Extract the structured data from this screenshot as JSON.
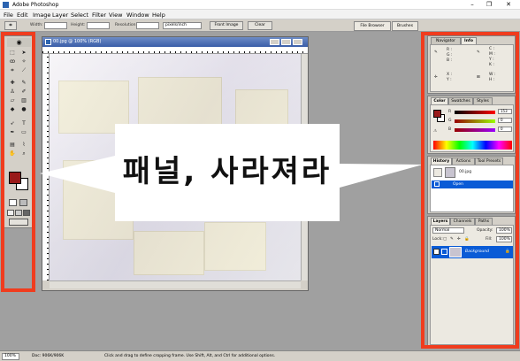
{
  "app": {
    "title": "Adobe Photoshop"
  },
  "window_controls": {
    "minimize": "–",
    "restore": "❐",
    "close": "✕"
  },
  "menu": [
    "File",
    "Edit",
    "Image",
    "Layer",
    "Select",
    "Filter",
    "View",
    "Window",
    "Help"
  ],
  "options_bar": {
    "tool_glyph": "⌗",
    "width_label": "Width:",
    "height_label": "Height:",
    "resolution_label": "Resolution:",
    "resolution_unit": "pixels/inch",
    "front_image": "Front Image",
    "clear": "Clear"
  },
  "palette_well": {
    "file_browser": "File Browser",
    "brushes": "Brushes"
  },
  "document": {
    "title": "00.jpg @ 100% (RGB)"
  },
  "callout": {
    "text": "패널, 사라져라"
  },
  "navigator": {
    "tabs": [
      "Navigator",
      "Info"
    ],
    "info_left": [
      "R :",
      "G :",
      "B :"
    ],
    "info_right": [
      "C :",
      "M :",
      "Y :",
      "K :"
    ],
    "info_xy": [
      "X :",
      "Y :"
    ],
    "info_wh": [
      "W :",
      "H :"
    ]
  },
  "color": {
    "tabs": [
      "Color",
      "Swatches",
      "Styles"
    ],
    "channels": [
      {
        "label": "R",
        "value": "153"
      },
      {
        "label": "G",
        "value": "0"
      },
      {
        "label": "B",
        "value": "0"
      }
    ],
    "accent": "#991a1a"
  },
  "history": {
    "tabs": [
      "History",
      "Actions",
      "Tool Presets"
    ],
    "snapshot": "00.jpg",
    "states": [
      {
        "label": "Open"
      }
    ]
  },
  "layers": {
    "tabs": [
      "Layers",
      "Channels",
      "Paths"
    ],
    "blend_mode": "Normal",
    "opacity_label": "Opacity:",
    "opacity_value": "100%",
    "lock_label": "Lock:",
    "fill_label": "Fill:",
    "fill_value": "100%",
    "layer_name": "Background"
  },
  "status": {
    "zoom": "100%",
    "doc": "Doc: 906K/906K",
    "hint": "Click and drag to define cropping frame. Use Shift, Alt, and Ctrl for additional options."
  },
  "highlight_color": "#f03c1e"
}
